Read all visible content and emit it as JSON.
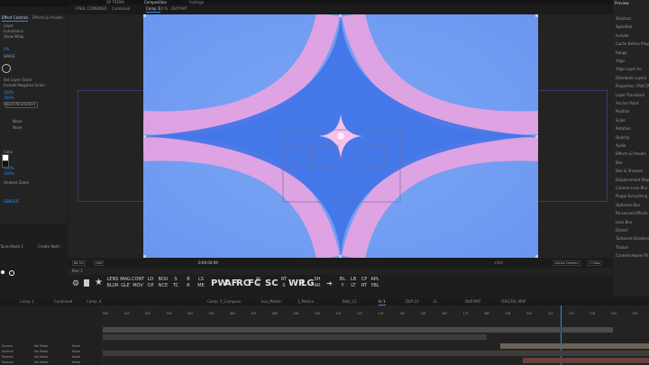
{
  "app": {
    "top_tabs": [
      "SP TREMA",
      "Composition",
      "Footage"
    ]
  },
  "left_panel": {
    "tabs": [
      "Effect Controls",
      "Effects & Presets"
    ],
    "rows": [
      {
        "label": "Layer",
        "value": "Layer Name"
      },
      {
        "label": "Luminance",
        "value": ""
      },
      {
        "label": "Show Wrap",
        "value": ""
      },
      {
        "label": "0%",
        "value": ""
      },
      {
        "label": "SPACE",
        "value": ""
      },
      {
        "label": "Set Layer Scale",
        "value": ""
      },
      {
        "label": "Include Negative Scale",
        "value": ""
      },
      {
        "label": "100%",
        "value": ""
      },
      {
        "label": "100%",
        "value": ""
      },
      {
        "label": "Reset Parameters",
        "value": ""
      },
      {
        "label": "None",
        "value": ""
      },
      {
        "label": "None",
        "value": ""
      },
      {
        "label": "Color",
        "value": ""
      },
      {
        "label": "100%",
        "value": ""
      },
      {
        "label": "100%",
        "value": ""
      },
      {
        "label": "Undeed Zoom",
        "value": ""
      },
      {
        "label": "RENDER",
        "value": ""
      }
    ],
    "footer": [
      "Tools Mode 1",
      "Create Nulls"
    ]
  },
  "comp_header": {
    "tabs": [
      "FINAL COMBINED",
      "Combined",
      "Comp 1",
      "10 fx",
      "Dkff MAT"
    ],
    "viewer_label": "Active Camera (Camera 1)"
  },
  "viewer_bar": {
    "zoom": "66.5%",
    "quality": "Half",
    "timecode": "0:00:04:09",
    "camera": "Active Camera",
    "views": "1 View",
    "offset": "+0.0"
  },
  "layer_bar": {
    "label": "Blur 1"
  },
  "toolbar_buttons": [
    {
      "top": "LENS",
      "bottom": "BLUR"
    },
    {
      "top": "MAG",
      "bottom": "GLE"
    },
    {
      "top": "CONT",
      "bottom": "MOV"
    },
    {
      "top": "LO",
      "bottom": "OP"
    },
    {
      "top": "BOU",
      "bottom": "NCE"
    },
    {
      "top": "S",
      "bottom": "TC"
    },
    {
      "top": "B",
      "bottom": "R"
    },
    {
      "top": "LS",
      "bottom": "ME"
    }
  ],
  "toolbar_big": [
    "PW",
    "AF",
    "RC",
    "FC",
    "SC",
    "WP",
    "LG"
  ],
  "toolbar_tail": [
    {
      "top": "AL",
      "bottom": "T"
    },
    {
      "top": "RT",
      "bottom": "S"
    },
    {
      "top": "SH",
      "bottom": "AR"
    },
    {
      "top": "BL",
      "bottom": "Y"
    },
    {
      "top": "LB",
      "bottom": "LT"
    },
    {
      "top": "CP",
      "bottom": "RT"
    },
    {
      "top": "APL",
      "bottom": "YBL"
    }
  ],
  "timeline_tabs": [
    "Comp 1",
    "Combined",
    "Comp",
    "4",
    "Comp",
    "5_Compose",
    "bus_Motion",
    "1_Motion",
    "Blitz_11",
    "fx 1",
    "Dkff 10",
    "11",
    "Dkff MAT",
    "FRACTAL MAP"
  ],
  "time_ruler": [
    "00f",
    "01f",
    "02f",
    "03f",
    "04f",
    "05f",
    "06f",
    "07f",
    "08f",
    "09f",
    "10f",
    "11f",
    "12f",
    "13f",
    "14f",
    "15f",
    "16f",
    "17f",
    "18f",
    "19f",
    "20f",
    "21f",
    "22f",
    "23f",
    "24f",
    "25f"
  ],
  "layers": [
    {
      "name": "Screen",
      "mode": "No Mode",
      "parent": "None"
    },
    {
      "name": "Normal",
      "mode": "No Mode",
      "parent": "None"
    },
    {
      "name": "Normal",
      "mode": "No Mode",
      "parent": "None"
    },
    {
      "name": "Normal",
      "mode": "No Mode",
      "parent": "None"
    }
  ],
  "right_panel": {
    "header": "Preview",
    "rows": [
      "Shortcut",
      "Spacebar",
      "Include",
      "Cache Before Playback",
      "Range",
      "Align",
      "Align Layer to:",
      "Distribute Layers",
      "Properties: FRACTAL MAP",
      "Layer Transform",
      "Anchor Point",
      "Position",
      "Scale",
      "Rotation",
      "Opacity",
      "Audio",
      "Effects & Presets",
      "Blur",
      "Blur & Sharpen",
      "Displacement Map",
      "Camera Lens Blur",
      "Plugin Everything",
      "Optimize Blur",
      "Re-Lensed Effects",
      "Lens Blur",
      "Distort",
      "Turbulent Displace",
      "Tracker",
      "Content-Aware Fill"
    ]
  },
  "colors": {
    "accent": "#2d8ceb",
    "viewer_blue": "#6f9bf2",
    "viewer_pink": "#f0a3df"
  }
}
